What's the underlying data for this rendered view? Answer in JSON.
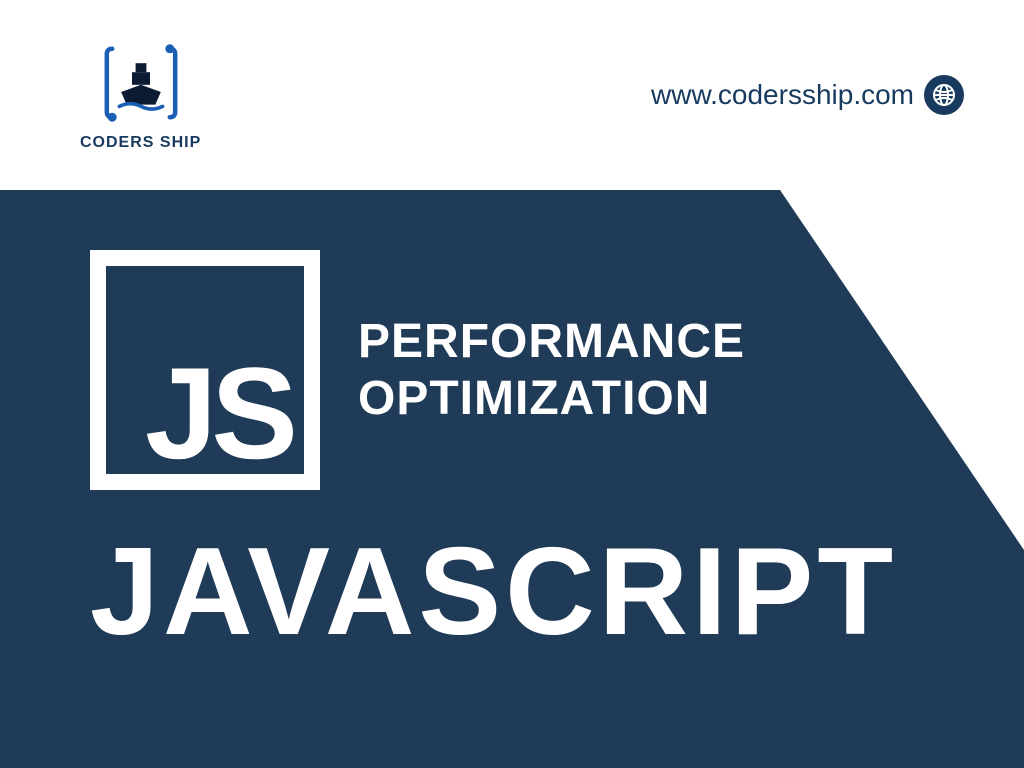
{
  "brand": {
    "label": "CODERS SHIP"
  },
  "url": {
    "text": "www.codersship.com"
  },
  "jsbox": {
    "letters": "JS"
  },
  "topic": {
    "line1": "PERFORMANCE",
    "line2": "OPTIMIZATION"
  },
  "title": {
    "text": "JAVASCRIPT"
  },
  "colors": {
    "navy": "#1f3b57",
    "navy_dark": "#173a5e",
    "white": "#ffffff"
  }
}
